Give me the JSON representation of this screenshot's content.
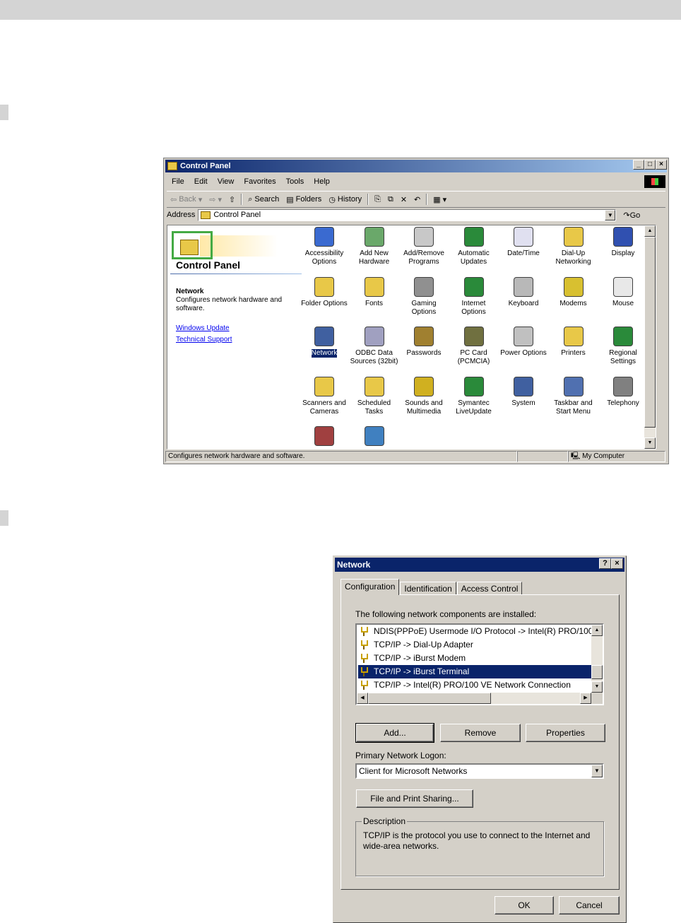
{
  "control_panel": {
    "title": "Control Panel",
    "menu": [
      "File",
      "Edit",
      "View",
      "Favorites",
      "Tools",
      "Help"
    ],
    "toolbar": {
      "back": "Back",
      "search": "Search",
      "folders": "Folders",
      "history": "History"
    },
    "address": {
      "label": "Address",
      "value": "Control Panel",
      "go": "Go"
    },
    "left_pane": {
      "heading": "Control Panel",
      "selected_name": "Network",
      "selected_desc": "Configures network hardware and software.",
      "links": [
        "Windows Update",
        "Technical Support"
      ]
    },
    "items": [
      {
        "label": "Accessibility\nOptions",
        "icon": "accessibility-icon",
        "color": "#3a6ad0"
      },
      {
        "label": "Add New\nHardware",
        "icon": "hardware-icon",
        "color": "#6aa86a"
      },
      {
        "label": "Add/Remove\nPrograms",
        "icon": "programs-icon",
        "color": "#c8c8c8"
      },
      {
        "label": "Automatic\nUpdates",
        "icon": "globe-icon",
        "color": "#2a8a3a"
      },
      {
        "label": "Date/Time",
        "icon": "calendar-icon",
        "color": "#e0e0f0"
      },
      {
        "label": "Dial-Up\nNetworking",
        "icon": "dialup-folder-icon",
        "color": "#e8c848"
      },
      {
        "label": "Display",
        "icon": "monitor-icon",
        "color": "#3050b0"
      },
      {
        "label": "Folder Options",
        "icon": "folder-options-icon",
        "color": "#e8c848"
      },
      {
        "label": "Fonts",
        "icon": "fonts-icon",
        "color": "#e8c848"
      },
      {
        "label": "Gaming\nOptions",
        "icon": "joystick-icon",
        "color": "#909090"
      },
      {
        "label": "Internet\nOptions",
        "icon": "internet-icon",
        "color": "#2a8a3a"
      },
      {
        "label": "Keyboard",
        "icon": "keyboard-icon",
        "color": "#b8b8b8"
      },
      {
        "label": "Modems",
        "icon": "modem-icon",
        "color": "#d8c030"
      },
      {
        "label": "Mouse",
        "icon": "mouse-icon",
        "color": "#e8e8e8"
      },
      {
        "label": "Network",
        "icon": "network-icon",
        "color": "#4060a0"
      },
      {
        "label": "ODBC Data\nSources (32bit)",
        "icon": "odbc-icon",
        "color": "#a0a0c0"
      },
      {
        "label": "Passwords",
        "icon": "keys-icon",
        "color": "#a08030"
      },
      {
        "label": "PC Card\n(PCMCIA)",
        "icon": "pccard-icon",
        "color": "#707040"
      },
      {
        "label": "Power Options",
        "icon": "power-icon",
        "color": "#c0c0c0"
      },
      {
        "label": "Printers",
        "icon": "printer-folder-icon",
        "color": "#e8c848"
      },
      {
        "label": "Regional\nSettings",
        "icon": "regional-globe-icon",
        "color": "#2a8a3a"
      },
      {
        "label": "Scanners and\nCameras",
        "icon": "scanner-folder-icon",
        "color": "#e8c848"
      },
      {
        "label": "Scheduled\nTasks",
        "icon": "tasks-folder-icon",
        "color": "#e8c848"
      },
      {
        "label": "Sounds and\nMultimedia",
        "icon": "speaker-icon",
        "color": "#d0b020"
      },
      {
        "label": "Symantec\nLiveUpdate",
        "icon": "liveupdate-icon",
        "color": "#2a8a3a"
      },
      {
        "label": "System",
        "icon": "computer-icon",
        "color": "#4060a0"
      },
      {
        "label": "Taskbar and\nStart Menu",
        "icon": "taskbar-icon",
        "color": "#5070b0"
      },
      {
        "label": "Telephony",
        "icon": "telephony-icon",
        "color": "#808080"
      },
      {
        "label": "",
        "icon": "users-icon",
        "color": "#a04040"
      },
      {
        "label": "",
        "icon": "wireless-link-icon",
        "color": "#4080c0"
      }
    ],
    "selected_item": "Network",
    "status": {
      "text": "Configures network hardware and software.",
      "zone": "My Computer"
    }
  },
  "network_dialog": {
    "title": "Network",
    "tabs": [
      "Configuration",
      "Identification",
      "Access Control"
    ],
    "components_label": "The following network components are installed:",
    "components": [
      "NDIS(PPPoE) Usermode I/O Protocol -> Intel(R) PRO/100",
      "TCP/IP -> Dial-Up Adapter",
      "TCP/IP -> iBurst Modem",
      "TCP/IP -> iBurst Terminal",
      "TCP/IP -> Intel(R) PRO/100 VE Network Connection"
    ],
    "selected_component": "TCP/IP -> iBurst Terminal",
    "buttons": {
      "add": "Add...",
      "remove": "Remove",
      "properties": "Properties",
      "file_print": "File and Print Sharing...",
      "ok": "OK",
      "cancel": "Cancel"
    },
    "logon_label": "Primary Network Logon:",
    "logon_value": "Client for Microsoft Networks",
    "description_title": "Description",
    "description_text": "TCP/IP is the protocol you use to connect to the Internet and wide-area networks."
  }
}
